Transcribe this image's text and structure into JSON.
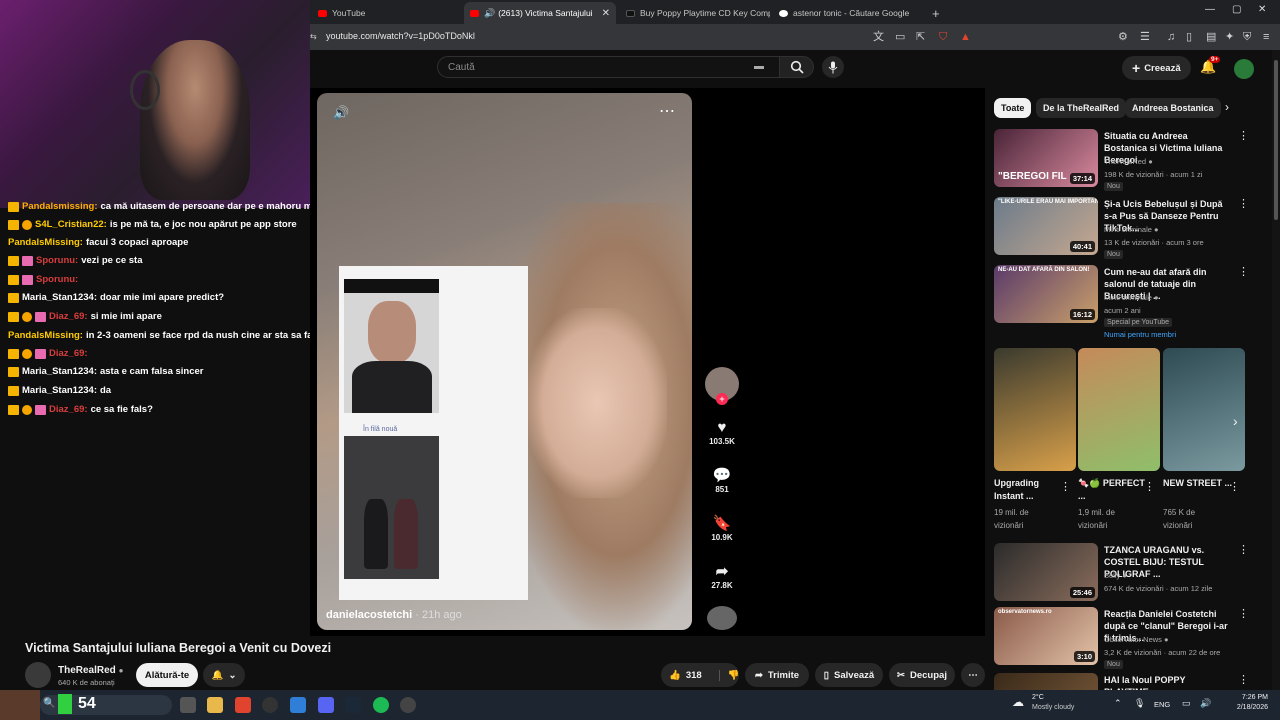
{
  "browser": {
    "tabs": [
      {
        "label": "YouTube",
        "color": "#ff0000"
      },
      {
        "label": "(2613) Victima Santajului Iulia",
        "color": "#ff0000"
      },
      {
        "label": "Buy Poppy Playtime CD Key Compar",
        "color": "#111111"
      },
      {
        "label": "astenor tonic - Căutare Google",
        "color": "#ffffff"
      }
    ],
    "new_tab": "+",
    "url": "youtube.com/watch?v=1pD0oTDoNkl"
  },
  "youtube": {
    "search_placeholder": "Caută",
    "create_label": "Creează",
    "notif_count": "9+"
  },
  "stream_chat": [
    {
      "user": "Pandalsmissing:",
      "msg": "ca mă uitasem de persoane dar pe e mahoru mahu",
      "color": "#ffb000",
      "badges": "b"
    },
    {
      "user": "S4L_Cristian22:",
      "msg": "is pe mă ta, e joc nou apărut pe app store",
      "color": "#ffcc00",
      "badges": "bc"
    },
    {
      "user": "PandalsMissing:",
      "msg": "facui 3 copaci aproape",
      "color": "#ffcc00",
      "badges": ""
    },
    {
      "user": "Sporunu:",
      "msg": "vezi pe ce sta",
      "color": "#d93d3d",
      "badges": "bg"
    },
    {
      "user": "Sporunu:",
      "msg": "",
      "color": "#d93d3d",
      "badges": "bg"
    },
    {
      "user": "Maria_Stan1234:",
      "msg": "doar mie imi apare predict?",
      "color": "#ffffff",
      "badges": "b"
    },
    {
      "user": "Diaz_69:",
      "msg": "si mie imi apare",
      "color": "#d93d3d",
      "badges": "bcg"
    },
    {
      "user": "PandalsMissing:",
      "msg": "in 2-3 oameni se face rpd da nush cine ar sta sa faca",
      "color": "#ffcc00",
      "badges": ""
    },
    {
      "user": "Diaz_69:",
      "msg": "",
      "color": "#d93d3d",
      "badges": "bcg"
    },
    {
      "user": "Maria_Stan1234:",
      "msg": "asta e cam falsa sincer",
      "color": "#ffffff",
      "badges": "b"
    },
    {
      "user": "Maria_Stan1234:",
      "msg": "da",
      "color": "#ffffff",
      "badges": "b"
    },
    {
      "user": "Diaz_69:",
      "msg": "ce sa fie fals?",
      "color": "#d93d3d",
      "badges": "bcg"
    }
  ],
  "video": {
    "overlay_caption": "În filă nouă",
    "creator": "danielacostetchi",
    "age": "· 21h ago",
    "likes": "103.5K",
    "comments": "851",
    "saves": "10.9K",
    "shares": "27.8K",
    "title": "Victima Santajului Iuliana Beregoi a Venit cu Dovezi",
    "channel": "TheRealRed",
    "subscribers": "640 K de abonați",
    "join": "Alătură-te",
    "like_count": "318",
    "share_label": "Trimite",
    "save_label": "Salvează",
    "clip_label": "Decupaj"
  },
  "chips": [
    "Toate",
    "De la TheRealRed",
    "Andreea Bostanica"
  ],
  "recommendations": [
    {
      "title": "Situatia cu Andreea Bostanica si Victima Iuliana Beregoi",
      "channel": "TheRealRed",
      "meta": "198 K de vizionări · acum 1 zi",
      "badge": "Nou",
      "duration": "37:14",
      "thumb_text": "\"BEREGOI FIL",
      "c1": "#4a2438",
      "c2": "#d98a9e"
    },
    {
      "title": "Și-a Ucis Bebelușul și După s-a Pus să Danseze Pentru TikTok...",
      "channel": "Minti criminale",
      "meta": "13 K de vizionări · acum 3 ore",
      "badge": "Nou",
      "duration": "40:41",
      "thumb_text": "\"LIKE-URILE ERAU MAI IMPORTANTE\"",
      "c1": "#6b7b8a",
      "c2": "#c6a890"
    },
    {
      "title": "Cum ne-au dat afară din salonul de tatuaje din București | ...",
      "channel": "Minti criminale",
      "meta": "acum 2 ani",
      "badge": "Special pe YouTube",
      "members": "Numai pentru membri",
      "duration": "16:12",
      "thumb_text": "NE-AU DAT AFARĂ DIN SALON!",
      "c1": "#5a3a6a",
      "c2": "#c9a06a"
    },
    {
      "title": "TZANCA URAGANU vs. COSTEL BIJU: TESTUL POLIGRAF ...",
      "channel": "Selly",
      "meta": "674 K de vizionări · acum 12 zile",
      "duration": "25:46",
      "c1": "#2b2b2b",
      "c2": "#8a6d5c"
    },
    {
      "title": "Reacția Danielei Costetchi după ce \"clanul\" Beregoi i-ar fi trimis...",
      "channel": "Observator News",
      "meta": "3,2 K de vizionări · acum 22 de ore",
      "badge": "Nou",
      "duration": "3:10",
      "thumb_text": "observatornews.ro",
      "c1": "#8a5a4a",
      "c2": "#e3c3a8"
    },
    {
      "title": "HAI la Noul POPPY PLAYTIME",
      "channel": "",
      "meta": "",
      "duration": "",
      "c1": "#3a2a1a",
      "c2": "#7a5a3a"
    }
  ],
  "shorts": [
    {
      "title": "Upgrading Instant ...",
      "meta": "19 mil. de vizionări",
      "c1": "#3a3a2e",
      "c2": "#d8a04a"
    },
    {
      "title": "🍬🍏 PERFECT ...",
      "meta": "1,9 mil. de vizionări",
      "c1": "#c58a5a",
      "c2": "#8fbf6a"
    },
    {
      "title": "NEW STREET ...",
      "meta": "765 K de vizionări",
      "c1": "#2e4a52",
      "c2": "#7a9aa0"
    }
  ],
  "webcam_counter": "54",
  "taskbar": {
    "weather_temp": "2°C",
    "weather_text": "Mostly cloudy",
    "lang": "ENG",
    "time": "7:26 PM",
    "date": "2/18/2026"
  }
}
